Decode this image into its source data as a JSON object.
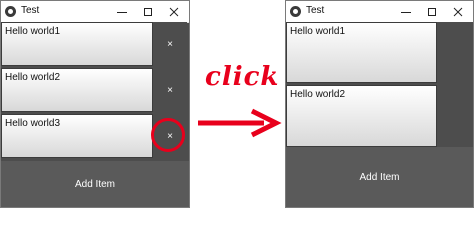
{
  "window_before": {
    "title": "Test",
    "items": [
      {
        "label": "Hello world1",
        "delete_label": "×"
      },
      {
        "label": "Hello world2",
        "delete_label": "×"
      },
      {
        "label": "Hello world3",
        "delete_label": "×"
      }
    ],
    "add_button_label": "Add Item"
  },
  "window_after": {
    "title": "Test",
    "items": [
      {
        "label": "Hello world1"
      },
      {
        "label": "Hello world2"
      }
    ],
    "add_button_label": "Add Item"
  },
  "annotation": {
    "click_text": "click",
    "accent_color": "#e8001c"
  }
}
